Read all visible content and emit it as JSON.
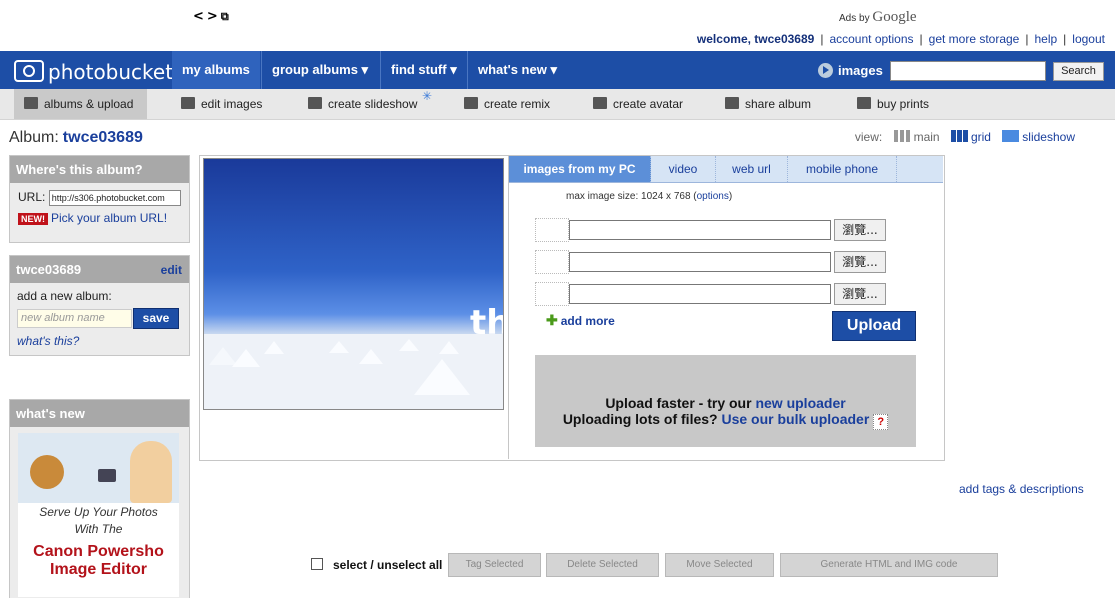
{
  "browser": {
    "back_glyph": "<",
    "forward_glyph": ">",
    "newwin_glyph": "⧉"
  },
  "ads": {
    "prefix": "Ads by",
    "brand": "Google"
  },
  "user_links": {
    "welcome": "welcome, twce03689",
    "account": "account options",
    "storage": "get more storage",
    "help": "help",
    "logout": "logout"
  },
  "brand": {
    "logo_text": "photobucket"
  },
  "nav": {
    "my_albums": "my albums",
    "group_albums": "group albums ▾",
    "find_stuff": "find stuff ▾",
    "whats_new": "what's new ▾"
  },
  "search": {
    "label": "images",
    "value": "",
    "button": "Search"
  },
  "subnav": {
    "albums_upload": "albums & upload",
    "edit_images": "edit images",
    "create_slideshow": "create slideshow",
    "create_remix": "create remix",
    "create_avatar": "create avatar",
    "share_album": "share album",
    "buy_prints": "buy prints",
    "star": "✳"
  },
  "album": {
    "label": "Album:",
    "name": "twce03689"
  },
  "view": {
    "label": "view:",
    "main": "main",
    "grid": "grid",
    "slideshow": "slideshow"
  },
  "where_panel": {
    "title": "Where's this album?",
    "url_label": "URL:",
    "url_value": "http://s306.photobucket.com",
    "new_badge": "NEW!",
    "pick_url": "Pick your album URL!"
  },
  "user_panel": {
    "username": "twce03689",
    "edit": "edit",
    "add_label": "add a new album:",
    "new_album_placeholder": "new album name",
    "save": "save",
    "whats_this": "what's this?"
  },
  "whats_new_panel": {
    "title": "what's new",
    "ad_line1": "Serve Up Your Photos",
    "ad_line2": "With The",
    "ad_line3": "Canon Powersho",
    "ad_line4": "Image Editor"
  },
  "preview": {
    "overlay_text": "th"
  },
  "upload_tabs": [
    "images from my PC",
    "video",
    "web url",
    "mobile phone"
  ],
  "upload": {
    "max_prefix": "max image size: 1024 x 768 (",
    "options": "options",
    "max_suffix": ")",
    "browse": "瀏覽...",
    "add_more": "add more",
    "add_more_icon": "✚",
    "upload_btn": "Upload",
    "faster_prefix": "Upload faster - try our ",
    "faster_link": "new uploader",
    "bulk_prefix": "Uploading lots of files? ",
    "bulk_link": "Use our bulk uploader",
    "help_glyph": "?"
  },
  "add_tags": "add tags & descriptions",
  "bottom": {
    "select_all": "select / unselect all",
    "tag": "Tag Selected",
    "delete": "Delete Selected",
    "move": "Move Selected",
    "generate": "Generate HTML and IMG code"
  }
}
